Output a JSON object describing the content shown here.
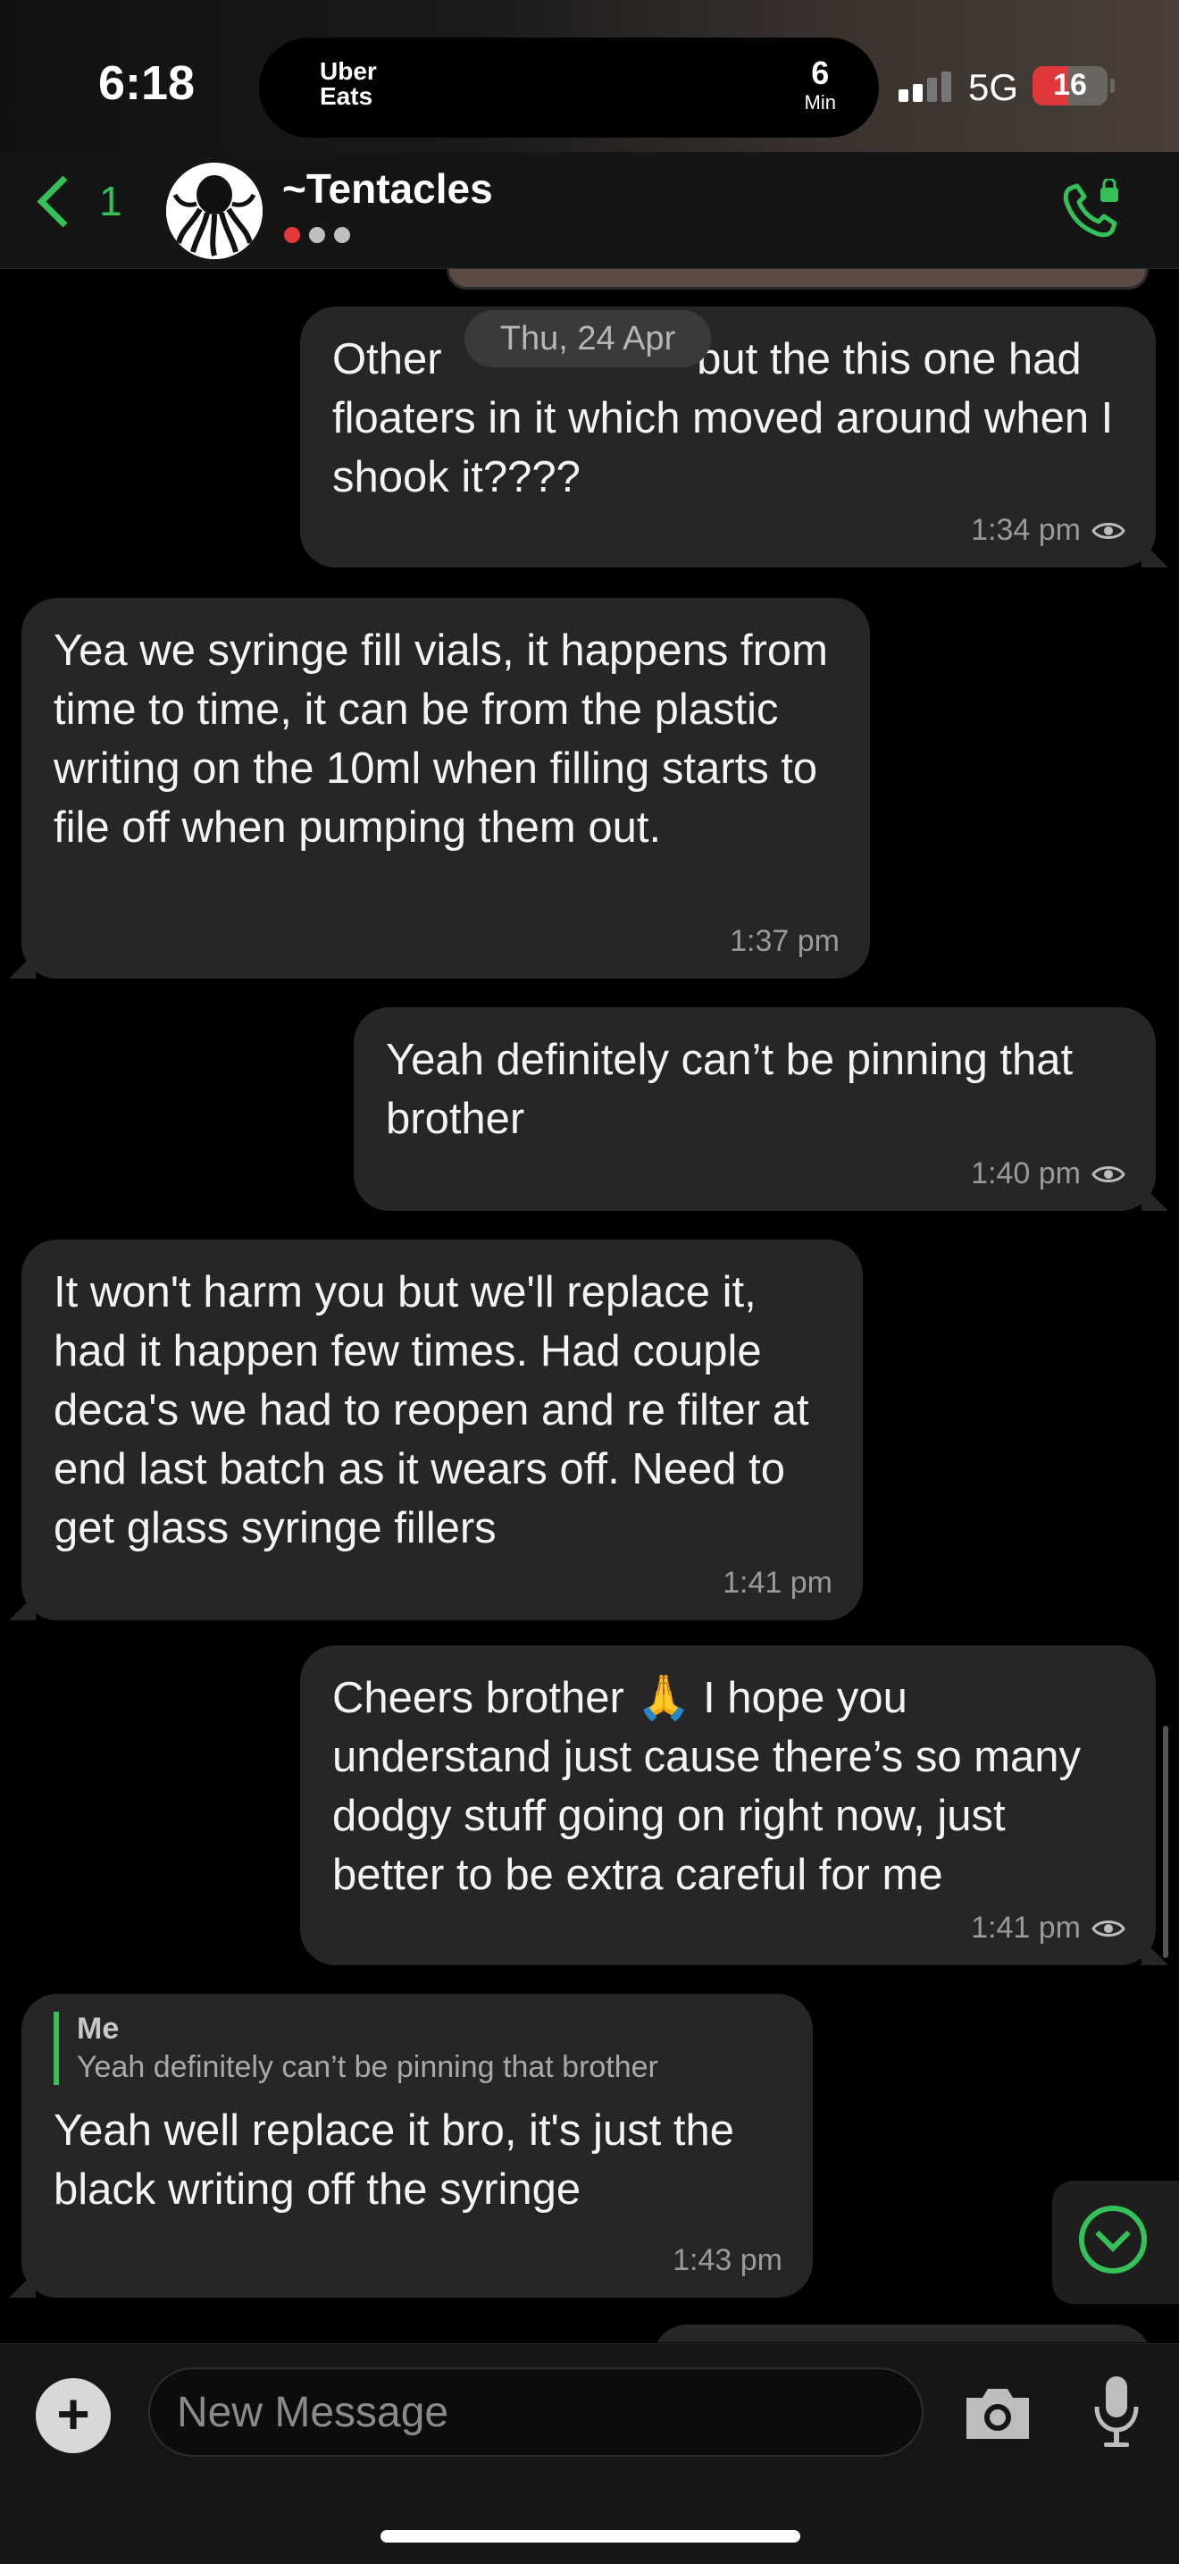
{
  "status_bar": {
    "time": "6:18",
    "live_activity": {
      "brand_line1": "Uber",
      "brand_line2": "Eats",
      "minutes": "6",
      "minutes_unit": "Min"
    },
    "network": "5G",
    "battery_level": "16",
    "signal_bars_active": 2
  },
  "header": {
    "back_count": "1",
    "contact_name": "~Tentacles",
    "status_dots": [
      "#e5373a",
      "#bfbfbf",
      "#bfbfbf"
    ],
    "accent_color": "#35c15a"
  },
  "date_separator": "Thu, 24 Apr",
  "messages": [
    {
      "direction": "outgoing",
      "text_part1": "Other ",
      "text_part2": "but the this one had floaters in it which moved around when I shook it????",
      "time": "1:34 pm",
      "seen_icon": "eye-icon"
    },
    {
      "direction": "incoming",
      "text": "Yea we syringe fill vials, it happens from time to time, it can be from the plastic writing on the 10ml when filling starts to file off when pumping them out.",
      "time": "1:37 pm"
    },
    {
      "direction": "outgoing",
      "text": "Yeah definitely can’t be pinning that brother",
      "time": "1:40 pm",
      "seen_icon": "eye-icon"
    },
    {
      "direction": "incoming",
      "text": "It won't harm you but we'll replace it, had it happen few times. Had couple deca's we had to reopen and re filter at end last batch as it wears off. Need to get glass syringe fillers",
      "time": "1:41 pm"
    },
    {
      "direction": "outgoing",
      "text_before_emoji": "Cheers brother ",
      "emoji": "🙏",
      "text_after_emoji": " I hope you understand just cause there’s so many dodgy stuff going on right now, just better to be extra careful for me",
      "time": "1:41 pm",
      "seen_icon": "eye-icon"
    },
    {
      "direction": "incoming",
      "quote_author": "Me",
      "quote_text": "Yeah definitely can’t be pinning that brother",
      "text": "Yeah well replace it bro, it's just the black writing off the syringe",
      "time": "1:43 pm"
    }
  ],
  "composer": {
    "placeholder": "New Message",
    "value": ""
  }
}
